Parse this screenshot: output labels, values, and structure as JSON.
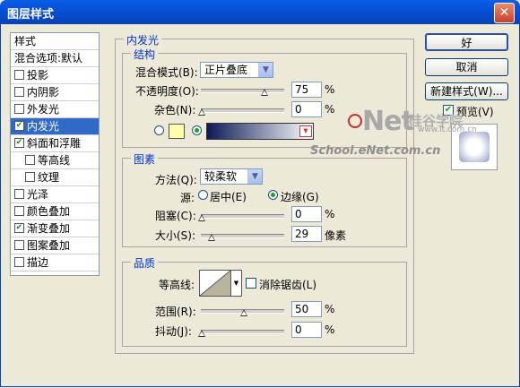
{
  "window": {
    "title": "图层样式",
    "close_glyph": "✕"
  },
  "left_list": [
    {
      "label": "样式",
      "checkbox": false
    },
    {
      "label": "混合选项:默认",
      "checkbox": false
    },
    {
      "label": "投影",
      "checkbox": true,
      "checked": false
    },
    {
      "label": "内阴影",
      "checkbox": true,
      "checked": false
    },
    {
      "label": "外发光",
      "checkbox": true,
      "checked": false
    },
    {
      "label": "内发光",
      "checkbox": true,
      "checked": true,
      "selected": true
    },
    {
      "label": "斜面和浮雕",
      "checkbox": true,
      "checked": true
    },
    {
      "label": "等高线",
      "checkbox": true,
      "checked": false,
      "sub": true
    },
    {
      "label": "纹理",
      "checkbox": true,
      "checked": false,
      "sub": true
    },
    {
      "label": "光泽",
      "checkbox": true,
      "checked": false
    },
    {
      "label": "颜色叠加",
      "checkbox": true,
      "checked": false
    },
    {
      "label": "渐变叠加",
      "checkbox": true,
      "checked": true
    },
    {
      "label": "图案叠加",
      "checkbox": true,
      "checked": false
    },
    {
      "label": "描边",
      "checkbox": true,
      "checked": false
    }
  ],
  "inner_glow": {
    "title": "内发光",
    "structure": {
      "title": "结构",
      "blend_mode_label": "混合模式(B):",
      "blend_mode_value": "正片叠底",
      "opacity_label": "不透明度(O):",
      "opacity_value": "75",
      "opacity_percent": 75,
      "noise_label": "杂色(N):",
      "noise_value": "0",
      "noise_percent": 0,
      "unit": "%",
      "glow_color_hex": "#FFFFAA",
      "gradient_start_hex": "#0C1A55",
      "gradient_end_hex": "#FFFFFF"
    },
    "elements": {
      "title": "图素",
      "method_label": "方法(Q):",
      "method_value": "较柔软",
      "source_label": "源:",
      "source_center": "居中(E)",
      "source_edge": "边缘(G)",
      "source_selected": "edge",
      "choke_label": "阻塞(C):",
      "choke_value": "0",
      "choke_percent": 0,
      "size_label": "大小(S):",
      "size_value": "29",
      "size_fraction": 0.12,
      "size_unit": "像素",
      "unit": "%"
    },
    "quality": {
      "title": "品质",
      "contour_label": "等高线:",
      "antialias_label": "消除锯齿(L)",
      "antialias_checked": false,
      "range_label": "范围(R):",
      "range_value": "50",
      "range_percent": 50,
      "jitter_label": "抖动(J):",
      "jitter_value": "0",
      "jitter_percent": 0,
      "unit": "%"
    }
  },
  "buttons": {
    "ok": "好",
    "cancel": "取消",
    "new_style": "新建样式(W)...",
    "preview": "预览(V)",
    "preview_checked": true
  },
  "watermark": {
    "logo": "Net",
    "cn_text": "硅谷学院",
    "site": "www.it.com.cn",
    "site2": "School.eNet.com.cn"
  }
}
